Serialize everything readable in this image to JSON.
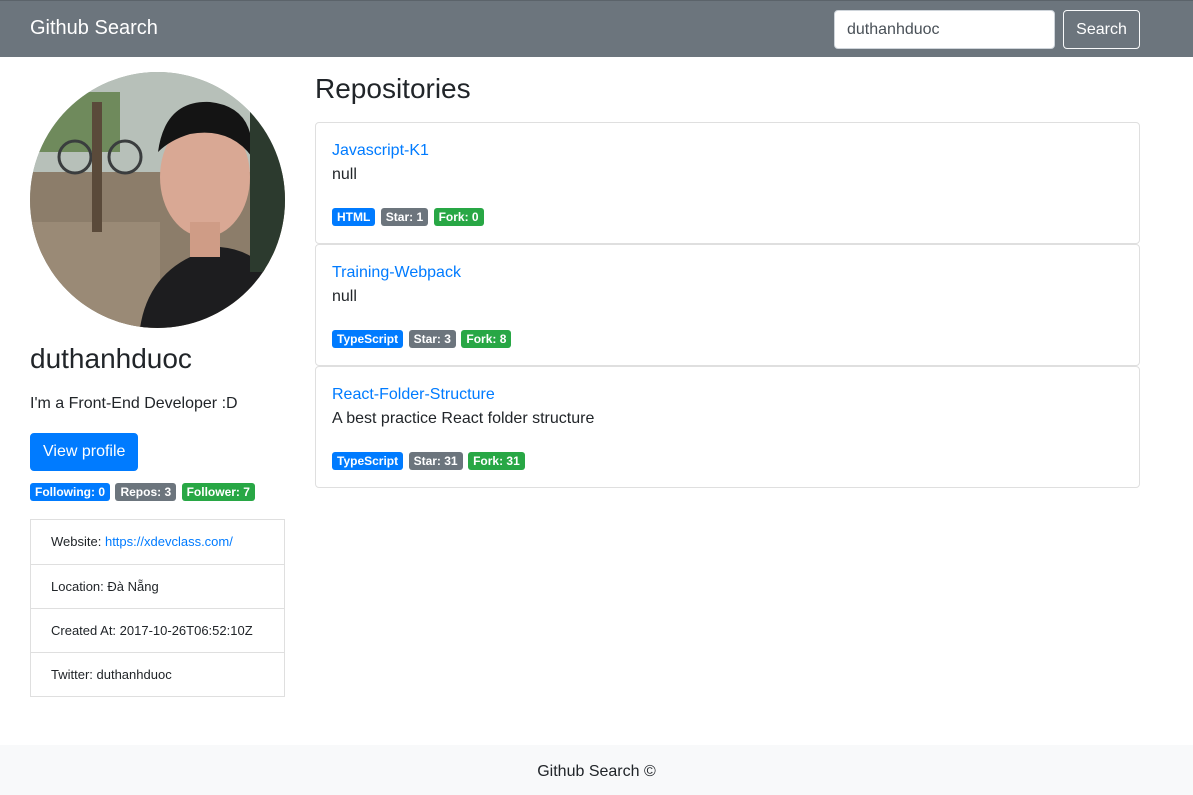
{
  "navbar": {
    "brand": "Github Search",
    "search_value": "duthanhduoc",
    "search_button": "Search"
  },
  "profile": {
    "username": "duthanhduoc",
    "bio": "I'm a Front-End Developer :D",
    "view_profile": "View profile",
    "badges": {
      "following": "Following: 0",
      "repos": "Repos: 3",
      "follower": "Follower: 7"
    },
    "info": {
      "website_label": "Website:",
      "website_url": "https://xdevclass.com/",
      "location": "Location: Đà Nẵng",
      "created_at": "Created At: 2017-10-26T06:52:10Z",
      "twitter": "Twitter: duthanhduoc"
    }
  },
  "repositories": {
    "title": "Repositories",
    "items": [
      {
        "name": "Javascript-K1",
        "description": "null",
        "language": "HTML",
        "stars": "Star: 1",
        "forks": "Fork: 0"
      },
      {
        "name": "Training-Webpack",
        "description": "null",
        "language": "TypeScript",
        "stars": "Star: 3",
        "forks": "Fork: 8"
      },
      {
        "name": "React-Folder-Structure",
        "description": "A best practice React folder structure",
        "language": "TypeScript",
        "stars": "Star: 31",
        "forks": "Fork: 31"
      }
    ]
  },
  "footer": {
    "text": "Github Search ©"
  },
  "colors": {
    "navbar": "#6c757d",
    "primary": "#007bff",
    "secondary": "#6c757d",
    "success": "#28a745"
  }
}
